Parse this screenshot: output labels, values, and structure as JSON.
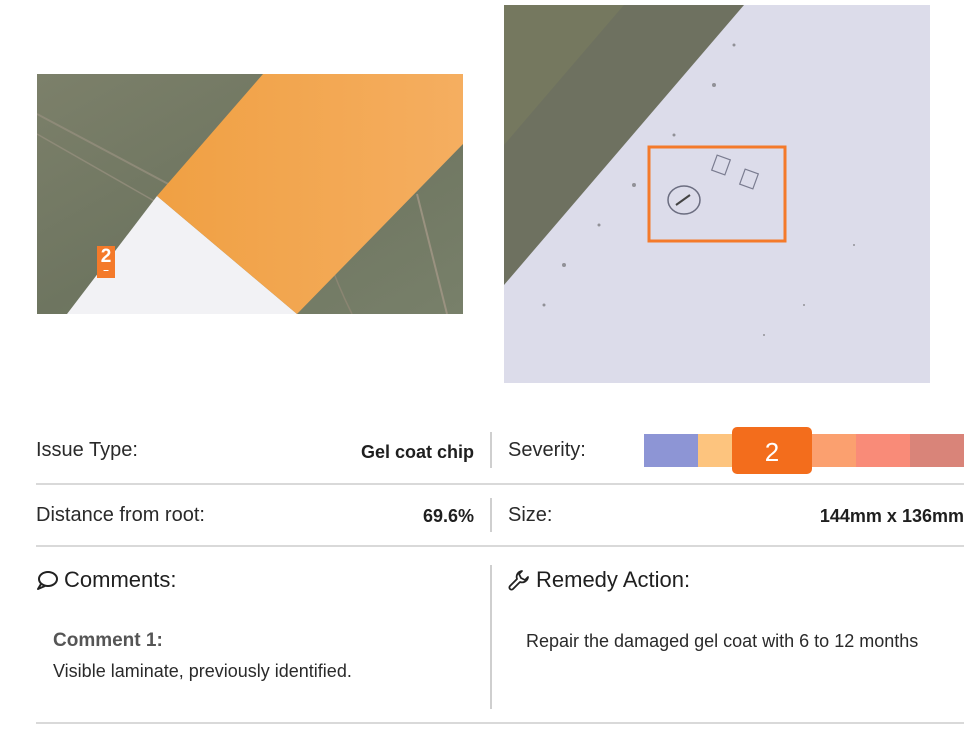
{
  "overview_image": {
    "marker_label": "2"
  },
  "fields": {
    "issue_type_label": "Issue Type:",
    "issue_type_value": "Gel coat chip",
    "severity_label": "Severity:",
    "severity_value": "2",
    "distance_label": "Distance from root:",
    "distance_value": "69.6%",
    "size_label": "Size:",
    "size_value": "144mm x 136mm"
  },
  "severity_scale": {
    "colors": [
      "#8d95d5",
      "#fdc47e",
      "#f36d1c",
      "#fba06f",
      "#f98b78",
      "#d98479"
    ]
  },
  "comments": {
    "title": "Comments:",
    "items": [
      {
        "heading": "Comment 1:",
        "text": "Visible laminate, previously identified."
      }
    ]
  },
  "remedy": {
    "title": "Remedy Action:",
    "text": "Repair the damaged gel coat with 6 to 12 months"
  },
  "colors": {
    "accent": "#f36d1c",
    "blade_orange": "#f3a04a"
  }
}
